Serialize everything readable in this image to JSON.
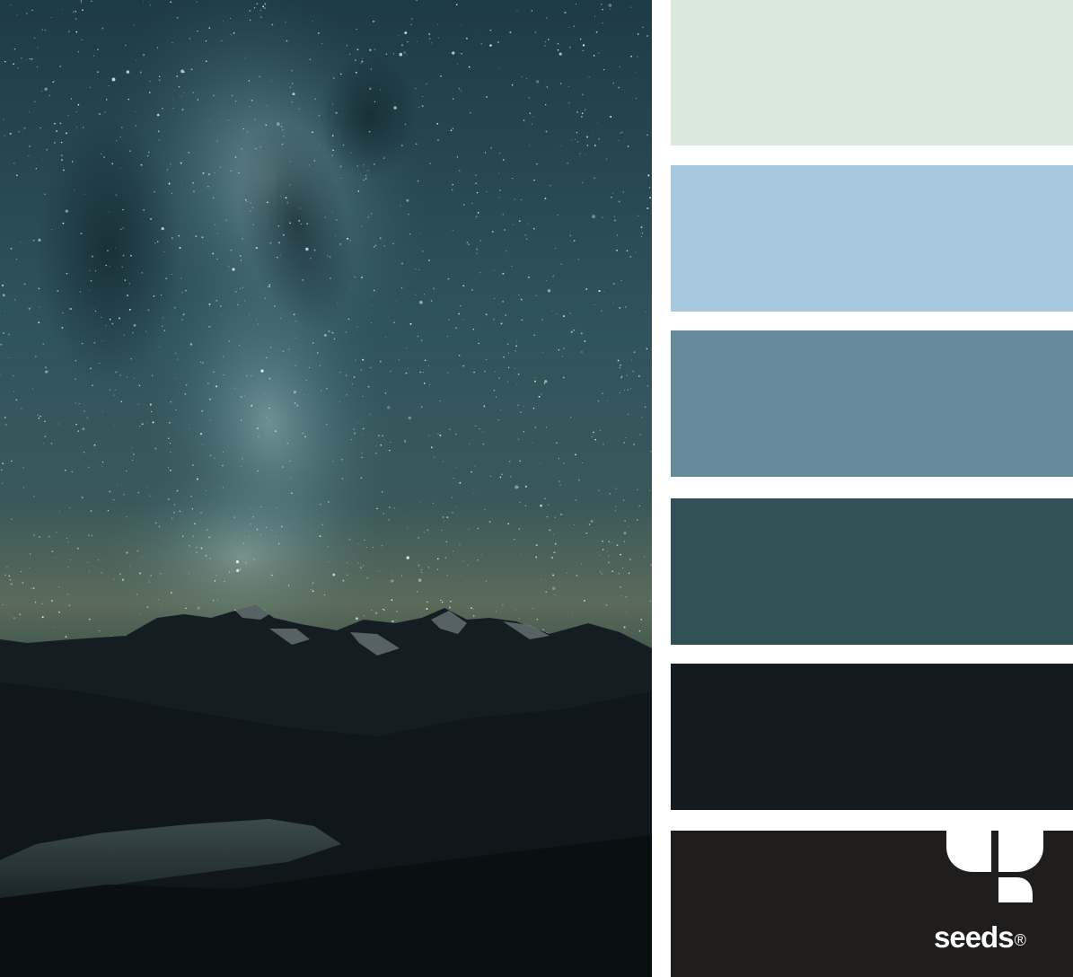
{
  "palette": {
    "swatches": [
      {
        "name": "mint",
        "color": "#d9e9de"
      },
      {
        "name": "sky-blue",
        "color": "#a7c8df"
      },
      {
        "name": "slate-blue",
        "color": "#668a9a"
      },
      {
        "name": "deep-teal",
        "color": "#325157"
      },
      {
        "name": "night",
        "color": "#131b1e"
      },
      {
        "name": "charcoal",
        "color": "#201e1d"
      }
    ]
  },
  "logo": {
    "wordmark": "seeds",
    "registered": "®",
    "icon": "seed-leaves-icon"
  },
  "photo": {
    "subject": "milky-way-over-mountains"
  }
}
